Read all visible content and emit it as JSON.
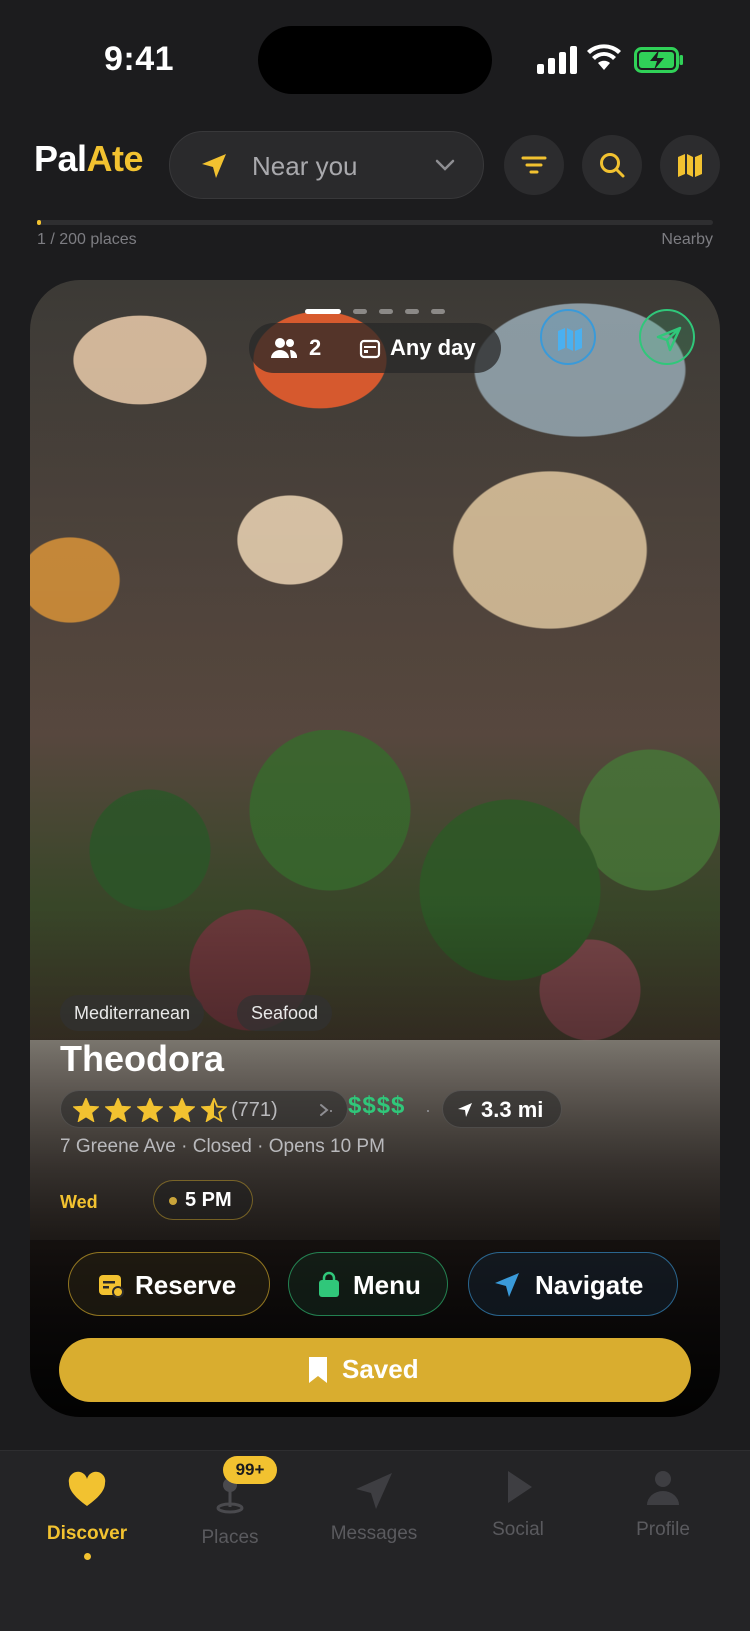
{
  "status_bar": {
    "time": "9:41"
  },
  "header": {
    "logo_part1": "Pal",
    "logo_part2": "Ate",
    "location_label": "Near you",
    "accent_color": "#f2c230"
  },
  "progress": {
    "label": "1 / 200 places",
    "right_label": "Nearby",
    "fraction": 0.005
  },
  "card": {
    "party_size": "2",
    "day": "Any day",
    "image_page_count": 5,
    "image_page_active": 1,
    "tags": [
      "Mediterranean",
      "Seafood"
    ],
    "name": "Theodora",
    "rating": 4.5,
    "review_count": "(771)",
    "price": "$$$$",
    "distance": "3.3 mi",
    "address_line": "7 Greene Ave · Closed · Opens 10 PM",
    "weekday": "Wed",
    "time_slot": "5 PM",
    "buttons": {
      "reserve": "Reserve",
      "menu": "Menu",
      "navigate": "Navigate",
      "saved": "Saved"
    }
  },
  "tabbar": {
    "items": [
      {
        "label": "Discover",
        "icon": "heart-icon",
        "active": true
      },
      {
        "label": "Places",
        "icon": "pin-icon",
        "badge": "99+"
      },
      {
        "label": "Messages",
        "icon": "send-icon"
      },
      {
        "label": "Social",
        "icon": "play-icon"
      },
      {
        "label": "Profile",
        "icon": "person-icon"
      }
    ]
  }
}
